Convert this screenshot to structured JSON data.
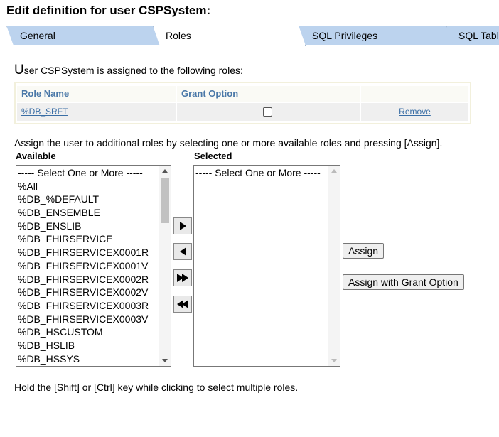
{
  "page": {
    "title": "Edit definition for user CSPSystem:"
  },
  "tabs": [
    {
      "label": "General"
    },
    {
      "label": "Roles"
    },
    {
      "label": "SQL Privileges"
    },
    {
      "label": "SQL Tables"
    }
  ],
  "assigned": {
    "first_letter": "U",
    "text": "ser CSPSystem is assigned to the following roles:",
    "headers": {
      "role_name": "Role Name",
      "grant_option": "Grant Option"
    },
    "rows": [
      {
        "role": "%DB_SRFT",
        "grant_checked": false,
        "action": "Remove"
      }
    ]
  },
  "instruction": "Assign the user to additional roles by selecting one or more available roles and pressing [Assign].",
  "available": {
    "label": "Available",
    "options": [
      "----- Select One or More -----",
      "%All",
      "%DB_%DEFAULT",
      "%DB_ENSEMBLE",
      "%DB_ENSLIB",
      "%DB_FHIRSERVICE",
      "%DB_FHIRSERVICEX0001R",
      "%DB_FHIRSERVICEX0001V",
      "%DB_FHIRSERVICEX0002R",
      "%DB_FHIRSERVICEX0002V",
      "%DB_FHIRSERVICEX0003R",
      "%DB_FHIRSERVICEX0003V",
      "%DB_HSCUSTOM",
      "%DB_HSLIB",
      "%DB_HSSYS"
    ]
  },
  "selected": {
    "label": "Selected",
    "options": [
      "----- Select One or More -----"
    ]
  },
  "move_buttons": [
    {
      "icon": "arrow-right-icon"
    },
    {
      "icon": "arrow-left-icon"
    },
    {
      "icon": "double-arrow-right-icon"
    },
    {
      "icon": "double-arrow-left-icon"
    }
  ],
  "buttons": {
    "assign": "Assign",
    "assign_grant": "Assign with Grant Option"
  },
  "footer": "Hold the [Shift] or [Ctrl] key while clicking to select multiple roles."
}
